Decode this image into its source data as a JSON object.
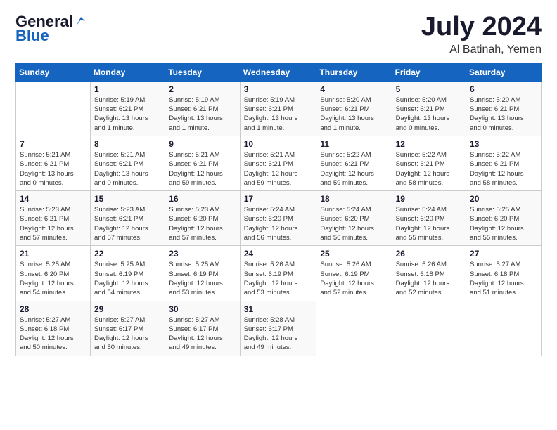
{
  "header": {
    "logo_general": "General",
    "logo_blue": "Blue",
    "month": "July 2024",
    "location": "Al Batinah, Yemen"
  },
  "columns": [
    "Sunday",
    "Monday",
    "Tuesday",
    "Wednesday",
    "Thursday",
    "Friday",
    "Saturday"
  ],
  "weeks": [
    [
      {
        "day": "",
        "info": ""
      },
      {
        "day": "1",
        "info": "Sunrise: 5:19 AM\nSunset: 6:21 PM\nDaylight: 13 hours\nand 1 minute."
      },
      {
        "day": "2",
        "info": "Sunrise: 5:19 AM\nSunset: 6:21 PM\nDaylight: 13 hours\nand 1 minute."
      },
      {
        "day": "3",
        "info": "Sunrise: 5:19 AM\nSunset: 6:21 PM\nDaylight: 13 hours\nand 1 minute."
      },
      {
        "day": "4",
        "info": "Sunrise: 5:20 AM\nSunset: 6:21 PM\nDaylight: 13 hours\nand 1 minute."
      },
      {
        "day": "5",
        "info": "Sunrise: 5:20 AM\nSunset: 6:21 PM\nDaylight: 13 hours\nand 0 minutes."
      },
      {
        "day": "6",
        "info": "Sunrise: 5:20 AM\nSunset: 6:21 PM\nDaylight: 13 hours\nand 0 minutes."
      }
    ],
    [
      {
        "day": "7",
        "info": "Sunrise: 5:21 AM\nSunset: 6:21 PM\nDaylight: 13 hours\nand 0 minutes."
      },
      {
        "day": "8",
        "info": "Sunrise: 5:21 AM\nSunset: 6:21 PM\nDaylight: 13 hours\nand 0 minutes."
      },
      {
        "day": "9",
        "info": "Sunrise: 5:21 AM\nSunset: 6:21 PM\nDaylight: 12 hours\nand 59 minutes."
      },
      {
        "day": "10",
        "info": "Sunrise: 5:21 AM\nSunset: 6:21 PM\nDaylight: 12 hours\nand 59 minutes."
      },
      {
        "day": "11",
        "info": "Sunrise: 5:22 AM\nSunset: 6:21 PM\nDaylight: 12 hours\nand 59 minutes."
      },
      {
        "day": "12",
        "info": "Sunrise: 5:22 AM\nSunset: 6:21 PM\nDaylight: 12 hours\nand 58 minutes."
      },
      {
        "day": "13",
        "info": "Sunrise: 5:22 AM\nSunset: 6:21 PM\nDaylight: 12 hours\nand 58 minutes."
      }
    ],
    [
      {
        "day": "14",
        "info": "Sunrise: 5:23 AM\nSunset: 6:21 PM\nDaylight: 12 hours\nand 57 minutes."
      },
      {
        "day": "15",
        "info": "Sunrise: 5:23 AM\nSunset: 6:21 PM\nDaylight: 12 hours\nand 57 minutes."
      },
      {
        "day": "16",
        "info": "Sunrise: 5:23 AM\nSunset: 6:20 PM\nDaylight: 12 hours\nand 57 minutes."
      },
      {
        "day": "17",
        "info": "Sunrise: 5:24 AM\nSunset: 6:20 PM\nDaylight: 12 hours\nand 56 minutes."
      },
      {
        "day": "18",
        "info": "Sunrise: 5:24 AM\nSunset: 6:20 PM\nDaylight: 12 hours\nand 56 minutes."
      },
      {
        "day": "19",
        "info": "Sunrise: 5:24 AM\nSunset: 6:20 PM\nDaylight: 12 hours\nand 55 minutes."
      },
      {
        "day": "20",
        "info": "Sunrise: 5:25 AM\nSunset: 6:20 PM\nDaylight: 12 hours\nand 55 minutes."
      }
    ],
    [
      {
        "day": "21",
        "info": "Sunrise: 5:25 AM\nSunset: 6:20 PM\nDaylight: 12 hours\nand 54 minutes."
      },
      {
        "day": "22",
        "info": "Sunrise: 5:25 AM\nSunset: 6:19 PM\nDaylight: 12 hours\nand 54 minutes."
      },
      {
        "day": "23",
        "info": "Sunrise: 5:25 AM\nSunset: 6:19 PM\nDaylight: 12 hours\nand 53 minutes."
      },
      {
        "day": "24",
        "info": "Sunrise: 5:26 AM\nSunset: 6:19 PM\nDaylight: 12 hours\nand 53 minutes."
      },
      {
        "day": "25",
        "info": "Sunrise: 5:26 AM\nSunset: 6:19 PM\nDaylight: 12 hours\nand 52 minutes."
      },
      {
        "day": "26",
        "info": "Sunrise: 5:26 AM\nSunset: 6:18 PM\nDaylight: 12 hours\nand 52 minutes."
      },
      {
        "day": "27",
        "info": "Sunrise: 5:27 AM\nSunset: 6:18 PM\nDaylight: 12 hours\nand 51 minutes."
      }
    ],
    [
      {
        "day": "28",
        "info": "Sunrise: 5:27 AM\nSunset: 6:18 PM\nDaylight: 12 hours\nand 50 minutes."
      },
      {
        "day": "29",
        "info": "Sunrise: 5:27 AM\nSunset: 6:17 PM\nDaylight: 12 hours\nand 50 minutes."
      },
      {
        "day": "30",
        "info": "Sunrise: 5:27 AM\nSunset: 6:17 PM\nDaylight: 12 hours\nand 49 minutes."
      },
      {
        "day": "31",
        "info": "Sunrise: 5:28 AM\nSunset: 6:17 PM\nDaylight: 12 hours\nand 49 minutes."
      },
      {
        "day": "",
        "info": ""
      },
      {
        "day": "",
        "info": ""
      },
      {
        "day": "",
        "info": ""
      }
    ]
  ]
}
